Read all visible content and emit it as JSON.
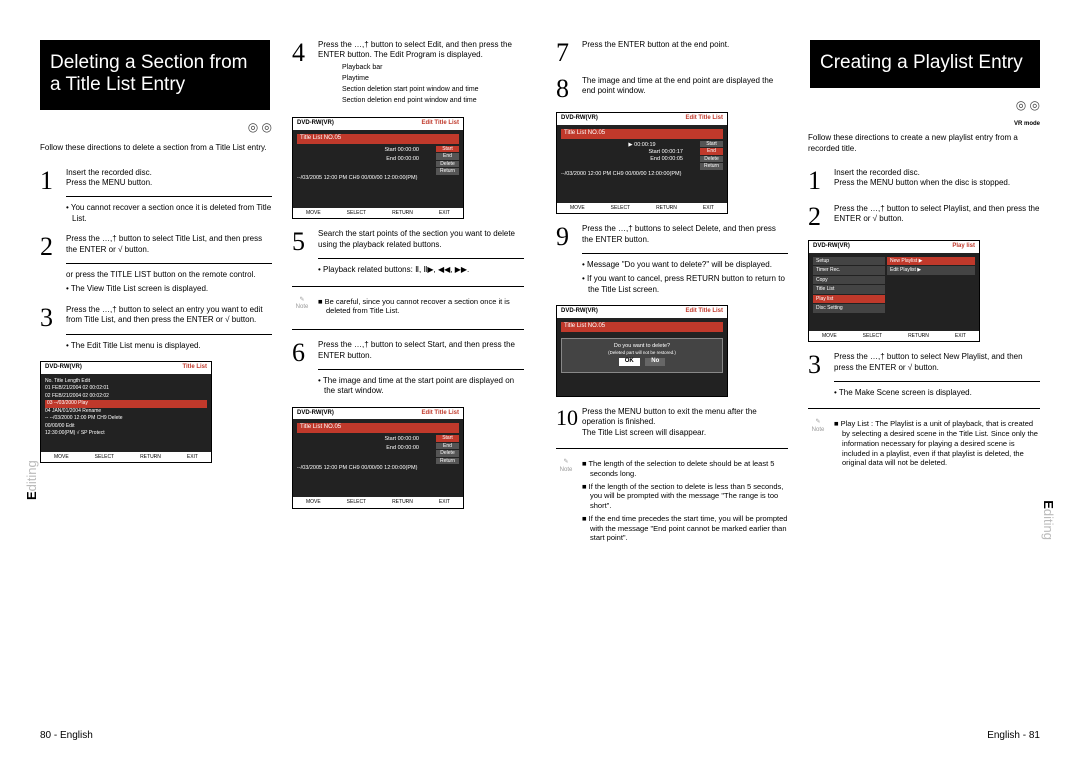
{
  "left": {
    "heading": "Deleting a Section from a Title List Entry",
    "intro": "Follow these directions to delete a section from a Title List entry.",
    "side_label_prefix": "E",
    "side_label_rest": "diting",
    "page_num": "80 - English",
    "step1": {
      "a": "Insert the recorded disc.",
      "b": "Press the MENU button.",
      "c": "• You cannot recover a section once it is deleted from Title List."
    },
    "step2": {
      "a": "Press the …,† button to select Title List, and then press the ENTER or √ button.",
      "b": "or press the TITLE LIST button on the remote control.",
      "c": "• The View Title List screen is displayed."
    },
    "step3": {
      "a": "Press the …,† button to select an entry you want to edit from Title List, and then press the ENTER or √ button.",
      "b": "• The Edit Title List menu is displayed."
    },
    "step4": {
      "a": "Press the …,† button to select Edit, and then press the ENTER button. The Edit Program is displayed.",
      "leg1": "Playback bar",
      "leg2": "Playtime",
      "leg3": "Section deletion start point window and time",
      "leg4": "Section deletion end point window and time"
    },
    "step5": {
      "a": "Search the start points of the section you want to delete using the playback related buttons.",
      "b": "• Playback related buttons: Ⅱ, Ⅱ▶, ◀◀, ▶▶."
    },
    "step6": {
      "a": "Press the …,† button to select Start, and then press the ENTER button.",
      "b": "• The image and time at the start point are displayed on the start window."
    },
    "note5": "■ Be careful, since you cannot recover a section once it is deleted from Title List.",
    "ss_title_list": {
      "top_l": "DVD-RW(VR)",
      "top_r": "Title List",
      "rows": [
        "No.  Title           Length  Edit",
        "01  FEB/21/2004 02  00:02:01",
        "02  FEB/21/2004 02  00:02:02",
        "03  --/03/2000      Play",
        "04  JAN/01/2004     Rename",
        "--  --/03/2000 12:00 PM CH9  Delete",
        "    00/00/00        Edit",
        "    12:30:00(PM) √  SP  Protect"
      ],
      "footer": [
        "MOVE",
        "SELECT",
        "RETURN",
        "EXIT"
      ]
    },
    "ss_edit": {
      "top_l": "DVD-RW(VR)",
      "top_r": "Edit Title List",
      "title": "Title List NO.05",
      "start": "Start  00:00:00",
      "end": "End  00:00:00",
      "info": "--/03/2005 12:00 PM CH9   00/00/00 12:00:00(PM)",
      "btns": [
        "Start",
        "End",
        "Delete",
        "Return"
      ],
      "footer": [
        "MOVE",
        "SELECT",
        "RETURN",
        "EXIT"
      ]
    }
  },
  "right": {
    "heading": "Creating a Playlist Entry",
    "intro": "Follow these directions to create a new playlist entry from a recorded title.",
    "vrmode": "VR mode",
    "side_label_prefix": "E",
    "side_label_rest": "diting",
    "page_num": "English - 81",
    "step7": {
      "a": "Press the ENTER button at the end point."
    },
    "step8": {
      "a": "The image and time at the end point are displayed the end point window."
    },
    "step9": {
      "a": "Press the …,† buttons to select Delete, and then press the ENTER button.",
      "b": "• Message \"Do you want to delete?\" will be displayed.",
      "c": "• If you want to cancel, press RETURN button to return to the Title List screen."
    },
    "step10": {
      "a": "Press the MENU button to exit the menu after the operation is finished.",
      "b": "The Title List screen will disappear."
    },
    "notes10a": "■ The length of the selection to delete should be at least 5 seconds long.",
    "notes10b": "■ If the length of the section to delete is less than 5 seconds, you will be prompted with the message \"The range is too short\".",
    "notes10c": "■ If the end time precedes the start time, you will be prompted with the message \"End point cannot be marked earlier than start point\".",
    "r_step1": {
      "a": "Insert the recorded disc.",
      "b": "Press the MENU button when the disc is stopped."
    },
    "r_step2": {
      "a": "Press the …,† button to select Playlist, and then press the ENTER or √ button."
    },
    "r_step3": {
      "a": "Press the …,† button to select New Playlist, and then press the ENTER or √ button.",
      "b": "• The Make Scene screen is displayed."
    },
    "r_note": "■ Play List : The Playlist is a unit of playback, that is created by selecting a desired scene in the Title List. Since only the information necessary for playing a desired scene is included in a playlist, even if that playlist is deleted, the original data will not be deleted.",
    "ss_edit8": {
      "top_l": "DVD-RW(VR)",
      "top_r": "Edit Title List",
      "title": "Title List NO.05",
      "play": "▶ 00:00:19",
      "start": "Start  00:00:17",
      "end": "End  00:00:05",
      "info": "--/03/2000 12:00 PM CH9   00/00/00 12:00:00(PM)",
      "btns": [
        "Start",
        "End",
        "Delete",
        "Return"
      ],
      "footer": [
        "MOVE",
        "SELECT",
        "RETURN",
        "EXIT"
      ]
    },
    "ss_confirm": {
      "top_l": "DVD-RW(VR)",
      "top_r": "Edit Title List",
      "title": "Title List NO.05",
      "msg": "Do you want to delete?",
      "msg2": "(Deleted part will not be restored.)",
      "ok": "OK",
      "no": "No"
    },
    "ss_playlist": {
      "top_l": "DVD-RW(VR)",
      "top_r": "Play list",
      "items": [
        "Setup",
        "Timer Rec.",
        "Copy",
        "Title List",
        "Play list",
        "Disc Setting"
      ],
      "sub": [
        "New Playlist  ▶",
        "Edit Playlist  ▶"
      ],
      "footer": [
        "MOVE",
        "SELECT",
        "RETURN",
        "EXIT"
      ]
    }
  }
}
